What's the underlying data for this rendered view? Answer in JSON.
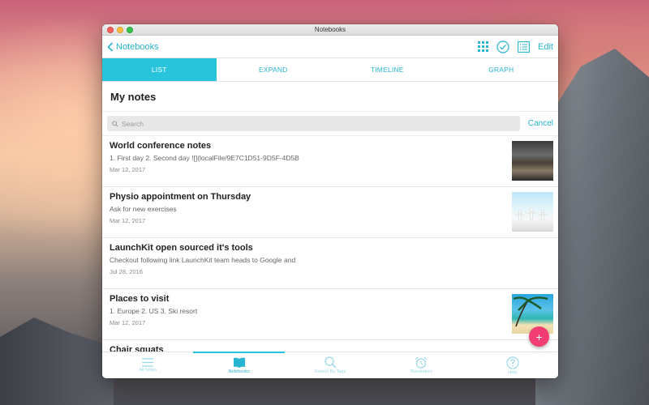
{
  "window": {
    "title": "Notebooks"
  },
  "navbar": {
    "back_label": "Notebooks",
    "edit_label": "Edit"
  },
  "tabs": [
    {
      "label": "LIST",
      "active": true
    },
    {
      "label": "EXPAND",
      "active": false
    },
    {
      "label": "TIMELINE",
      "active": false
    },
    {
      "label": "GRAPH",
      "active": false
    }
  ],
  "section": {
    "title": "My notes"
  },
  "search": {
    "placeholder": "Search",
    "value": "",
    "cancel_label": "Cancel"
  },
  "notes": [
    {
      "title": "World conference notes",
      "preview": "1. First day 2. Second day ![](localFile/9E7C1D51-9D5F-4D5B",
      "date": "Mar 12, 2017",
      "thumb": "conference"
    },
    {
      "title": "Physio appointment on Thursday",
      "preview": "Ask for new exercises",
      "date": "Mar 12, 2017",
      "thumb": "yoga"
    },
    {
      "title": "LaunchKit open sourced it's tools",
      "preview": "Checkout following link LaunchKit team heads to Google and",
      "date": "Jul 28, 2016",
      "thumb": ""
    },
    {
      "title": "Places to visit",
      "preview": "1. Europe 2. US 3. Ski resort",
      "date": "Mar 12, 2017",
      "thumb": "beach"
    },
    {
      "title": "Chair squats",
      "preview": "",
      "date": "",
      "thumb": ""
    }
  ],
  "fab": {
    "label": "+"
  },
  "tabbar": [
    {
      "label": "All Notes",
      "icon": "list-icon",
      "active": false
    },
    {
      "label": "Notebooks",
      "icon": "book-icon",
      "active": true
    },
    {
      "label": "Search By Tags",
      "icon": "search-icon",
      "active": false
    },
    {
      "label": "Reminders",
      "icon": "alarm-clock-icon",
      "active": false
    },
    {
      "label": "Help",
      "icon": "help-icon",
      "active": false
    }
  ],
  "colors": {
    "accent": "#28c4dc",
    "fab": "#f23d74"
  }
}
